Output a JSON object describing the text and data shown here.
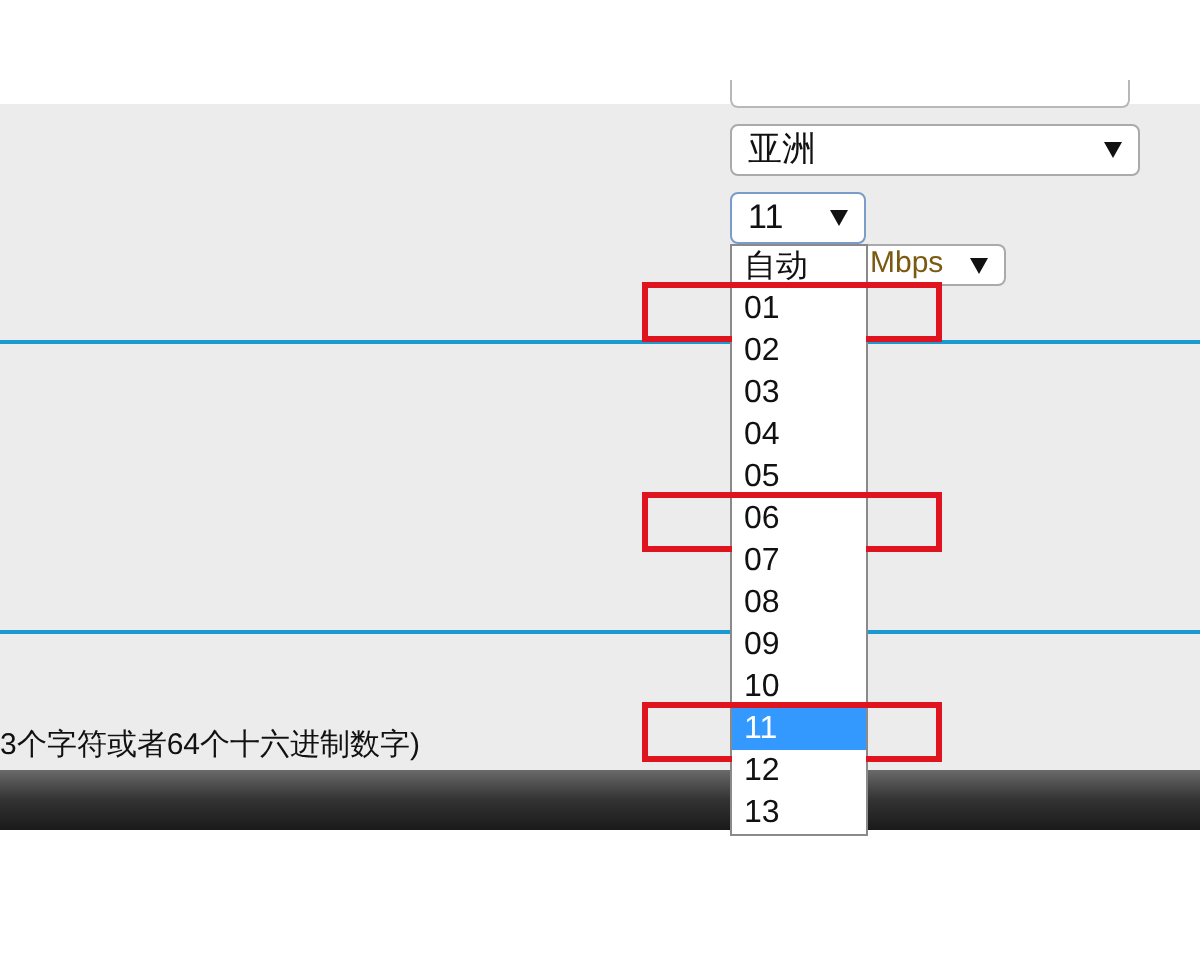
{
  "region_select": {
    "value": "亚洲"
  },
  "channel_select": {
    "value": "11",
    "expanded": true,
    "options": [
      {
        "label": "自动",
        "selected": false,
        "annotated": false
      },
      {
        "label": "01",
        "selected": false,
        "annotated": true
      },
      {
        "label": "02",
        "selected": false,
        "annotated": false
      },
      {
        "label": "03",
        "selected": false,
        "annotated": false
      },
      {
        "label": "04",
        "selected": false,
        "annotated": false
      },
      {
        "label": "05",
        "selected": false,
        "annotated": false
      },
      {
        "label": "06",
        "selected": false,
        "annotated": true
      },
      {
        "label": "07",
        "selected": false,
        "annotated": false
      },
      {
        "label": "08",
        "selected": false,
        "annotated": false
      },
      {
        "label": "09",
        "selected": false,
        "annotated": false
      },
      {
        "label": "10",
        "selected": false,
        "annotated": false
      },
      {
        "label": "11",
        "selected": true,
        "annotated": true
      },
      {
        "label": "12",
        "selected": false,
        "annotated": false
      },
      {
        "label": "13",
        "selected": false,
        "annotated": false
      }
    ]
  },
  "rate_select": {
    "value": "Mbps"
  },
  "hint": "3个字符或者64个十六进制数字)"
}
